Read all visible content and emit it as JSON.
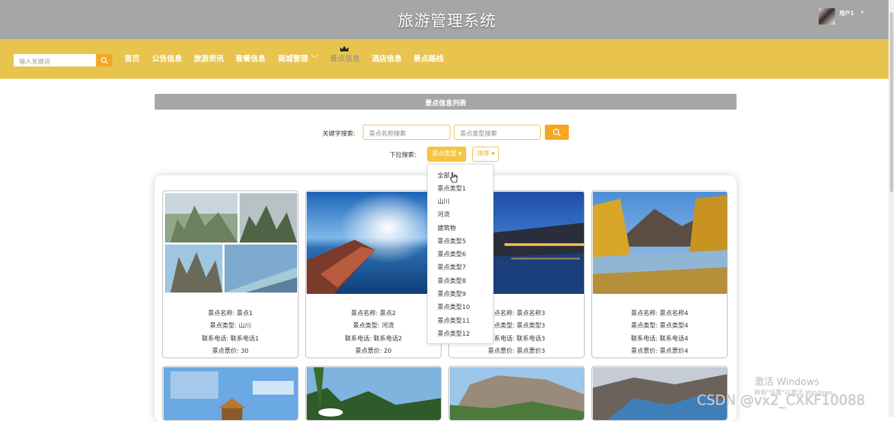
{
  "header": {
    "title": "旅游管理系统",
    "username": "用户1"
  },
  "nav": {
    "search_placeholder": "输入关键词",
    "items": [
      "首页",
      "公告信息",
      "旅游资讯",
      "套餐信息",
      "商城管理",
      "景点信息",
      "酒店信息",
      "景点路线"
    ],
    "active": "景点信息"
  },
  "section": {
    "title": "景点信息列表"
  },
  "filters": {
    "keyword_label": "关键字搜索:",
    "name_placeholder": "景点名称搜索",
    "type_placeholder": "景点类型搜索",
    "dropdown_label": "下拉搜索:",
    "type_button": "景点类型",
    "sort_button": "排序"
  },
  "dropdown": {
    "options": [
      "全部",
      "景点类型1",
      "山川",
      "河流",
      "建筑物",
      "景点类型5",
      "景点类型6",
      "景点类型7",
      "景点类型8",
      "景点类型9",
      "景点类型10",
      "景点类型11",
      "景点类型12"
    ]
  },
  "cards": [
    {
      "lines": [
        "景点名称: 景点1",
        "景点类型: 山川",
        "联系电话: 联系电话1",
        "景点票价: 30"
      ]
    },
    {
      "lines": [
        "景点名称: 景点2",
        "景点类型: 河流",
        "联系电话: 联系电话2",
        "景点票价: 20"
      ]
    },
    {
      "lines": [
        "景点名称: 景点名称3",
        "景点类型: 景点类型3",
        "联系电话: 联系电话3",
        "景点票价: 景点票价3"
      ]
    },
    {
      "lines": [
        "景点名称: 景点名称4",
        "景点类型: 景点类型4",
        "联系电话: 联系电话4",
        "景点票价: 景点票价4"
      ]
    }
  ],
  "watermark": {
    "line1": "激活 Windows",
    "line2": "转到\"设置\"以激活 Windows。",
    "csdn": "CSDN @vx2_CXKF10088"
  },
  "colors": {
    "accent": "#e8c44f",
    "button": "#f5a623",
    "header_bg": "#a6a6a6"
  }
}
